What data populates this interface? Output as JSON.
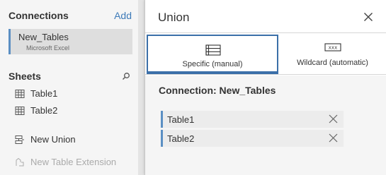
{
  "connections": {
    "title": "Connections",
    "add_label": "Add",
    "items": [
      {
        "name": "New_Tables",
        "type": "Microsoft Excel"
      }
    ]
  },
  "sheets": {
    "title": "Sheets",
    "items": [
      {
        "label": "Table1",
        "icon": "table-grid-icon"
      },
      {
        "label": "Table2",
        "icon": "table-grid-icon"
      }
    ]
  },
  "actions": {
    "new_union": "New Union",
    "new_table_extension": "New Table Extension"
  },
  "dialog": {
    "title": "Union",
    "tabs": [
      {
        "label": "Specific (manual)",
        "icon": "table-stack-icon",
        "active": true
      },
      {
        "label": "Wildcard (automatic)",
        "icon": "wildcard-icon",
        "active": false
      }
    ],
    "connection_heading": "Connection: New_Tables",
    "tables": [
      "Table1",
      "Table2"
    ]
  },
  "colors": {
    "accent": "#3b6fa8",
    "selection_bar": "#5b8fc3",
    "link": "#3d7ab8"
  }
}
